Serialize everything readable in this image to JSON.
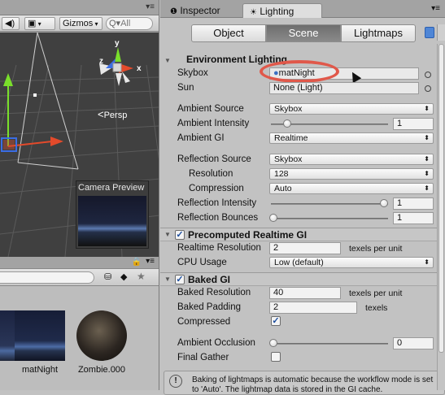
{
  "scene": {
    "toolbar": {
      "audio_icon": "speaker-icon",
      "fx_icon": "image-icon",
      "gizmos_label": "Gizmos",
      "search_prefix": "Q▾",
      "search_text": "All"
    },
    "persp_label": "Persp",
    "camera_preview_title": "Camera Preview",
    "gizmo_axes": {
      "y": "y",
      "x": "x",
      "z": "z"
    }
  },
  "project": {
    "assets": [
      {
        "name": "matNight"
      },
      {
        "name": "Zombie.000"
      }
    ]
  },
  "tabs": [
    {
      "label": "Inspector"
    },
    {
      "label": "Lighting"
    }
  ],
  "modes": [
    {
      "label": "Object",
      "active": false
    },
    {
      "label": "Scene",
      "active": true
    },
    {
      "label": "Lightmaps",
      "active": false
    }
  ],
  "environment": {
    "header": "Environment Lighting",
    "skybox_label": "Skybox",
    "skybox_value": "matNight",
    "sun_label": "Sun",
    "sun_value": "None (Light)",
    "ambient_source_label": "Ambient Source",
    "ambient_source_value": "Skybox",
    "ambient_intensity_label": "Ambient Intensity",
    "ambient_intensity_value": "1",
    "ambient_intensity_fraction": 0.125,
    "ambient_gi_label": "Ambient GI",
    "ambient_gi_value": "Realtime",
    "reflection_source_label": "Reflection Source",
    "reflection_source_value": "Skybox",
    "resolution_label": "Resolution",
    "resolution_value": "128",
    "compression_label": "Compression",
    "compression_value": "Auto",
    "reflection_intensity_label": "Reflection Intensity",
    "reflection_intensity_value": "1",
    "reflection_intensity_fraction": 1.0,
    "reflection_bounces_label": "Reflection Bounces",
    "reflection_bounces_value": "1",
    "reflection_bounces_fraction": 0.0
  },
  "precomputed": {
    "header": "Precomputed Realtime GI",
    "enabled": true,
    "realtime_resolution_label": "Realtime Resolution",
    "realtime_resolution_value": "2",
    "realtime_resolution_unit": "texels per unit",
    "cpu_usage_label": "CPU Usage",
    "cpu_usage_value": "Low (default)"
  },
  "baked": {
    "header": "Baked GI",
    "enabled": true,
    "baked_resolution_label": "Baked Resolution",
    "baked_resolution_value": "40",
    "baked_resolution_unit": "texels per unit",
    "baked_padding_label": "Baked Padding",
    "baked_padding_value": "2",
    "baked_padding_unit": "texels",
    "compressed_label": "Compressed",
    "compressed": true,
    "ambient_occlusion_label": "Ambient Occlusion",
    "ambient_occlusion_value": "0",
    "ambient_occlusion_fraction": 0.0,
    "final_gather_label": "Final Gather",
    "final_gather": false
  },
  "info_message": {
    "line1": "Baking of lightmaps is automatic because the workflow mode is set",
    "line2": "to 'Auto'. The lightmap data is stored in the GI cache."
  },
  "colors": {
    "highlight_ring": "#e0584a",
    "active_mode": "#787878",
    "checkbox_check": "#1c4d9e"
  }
}
